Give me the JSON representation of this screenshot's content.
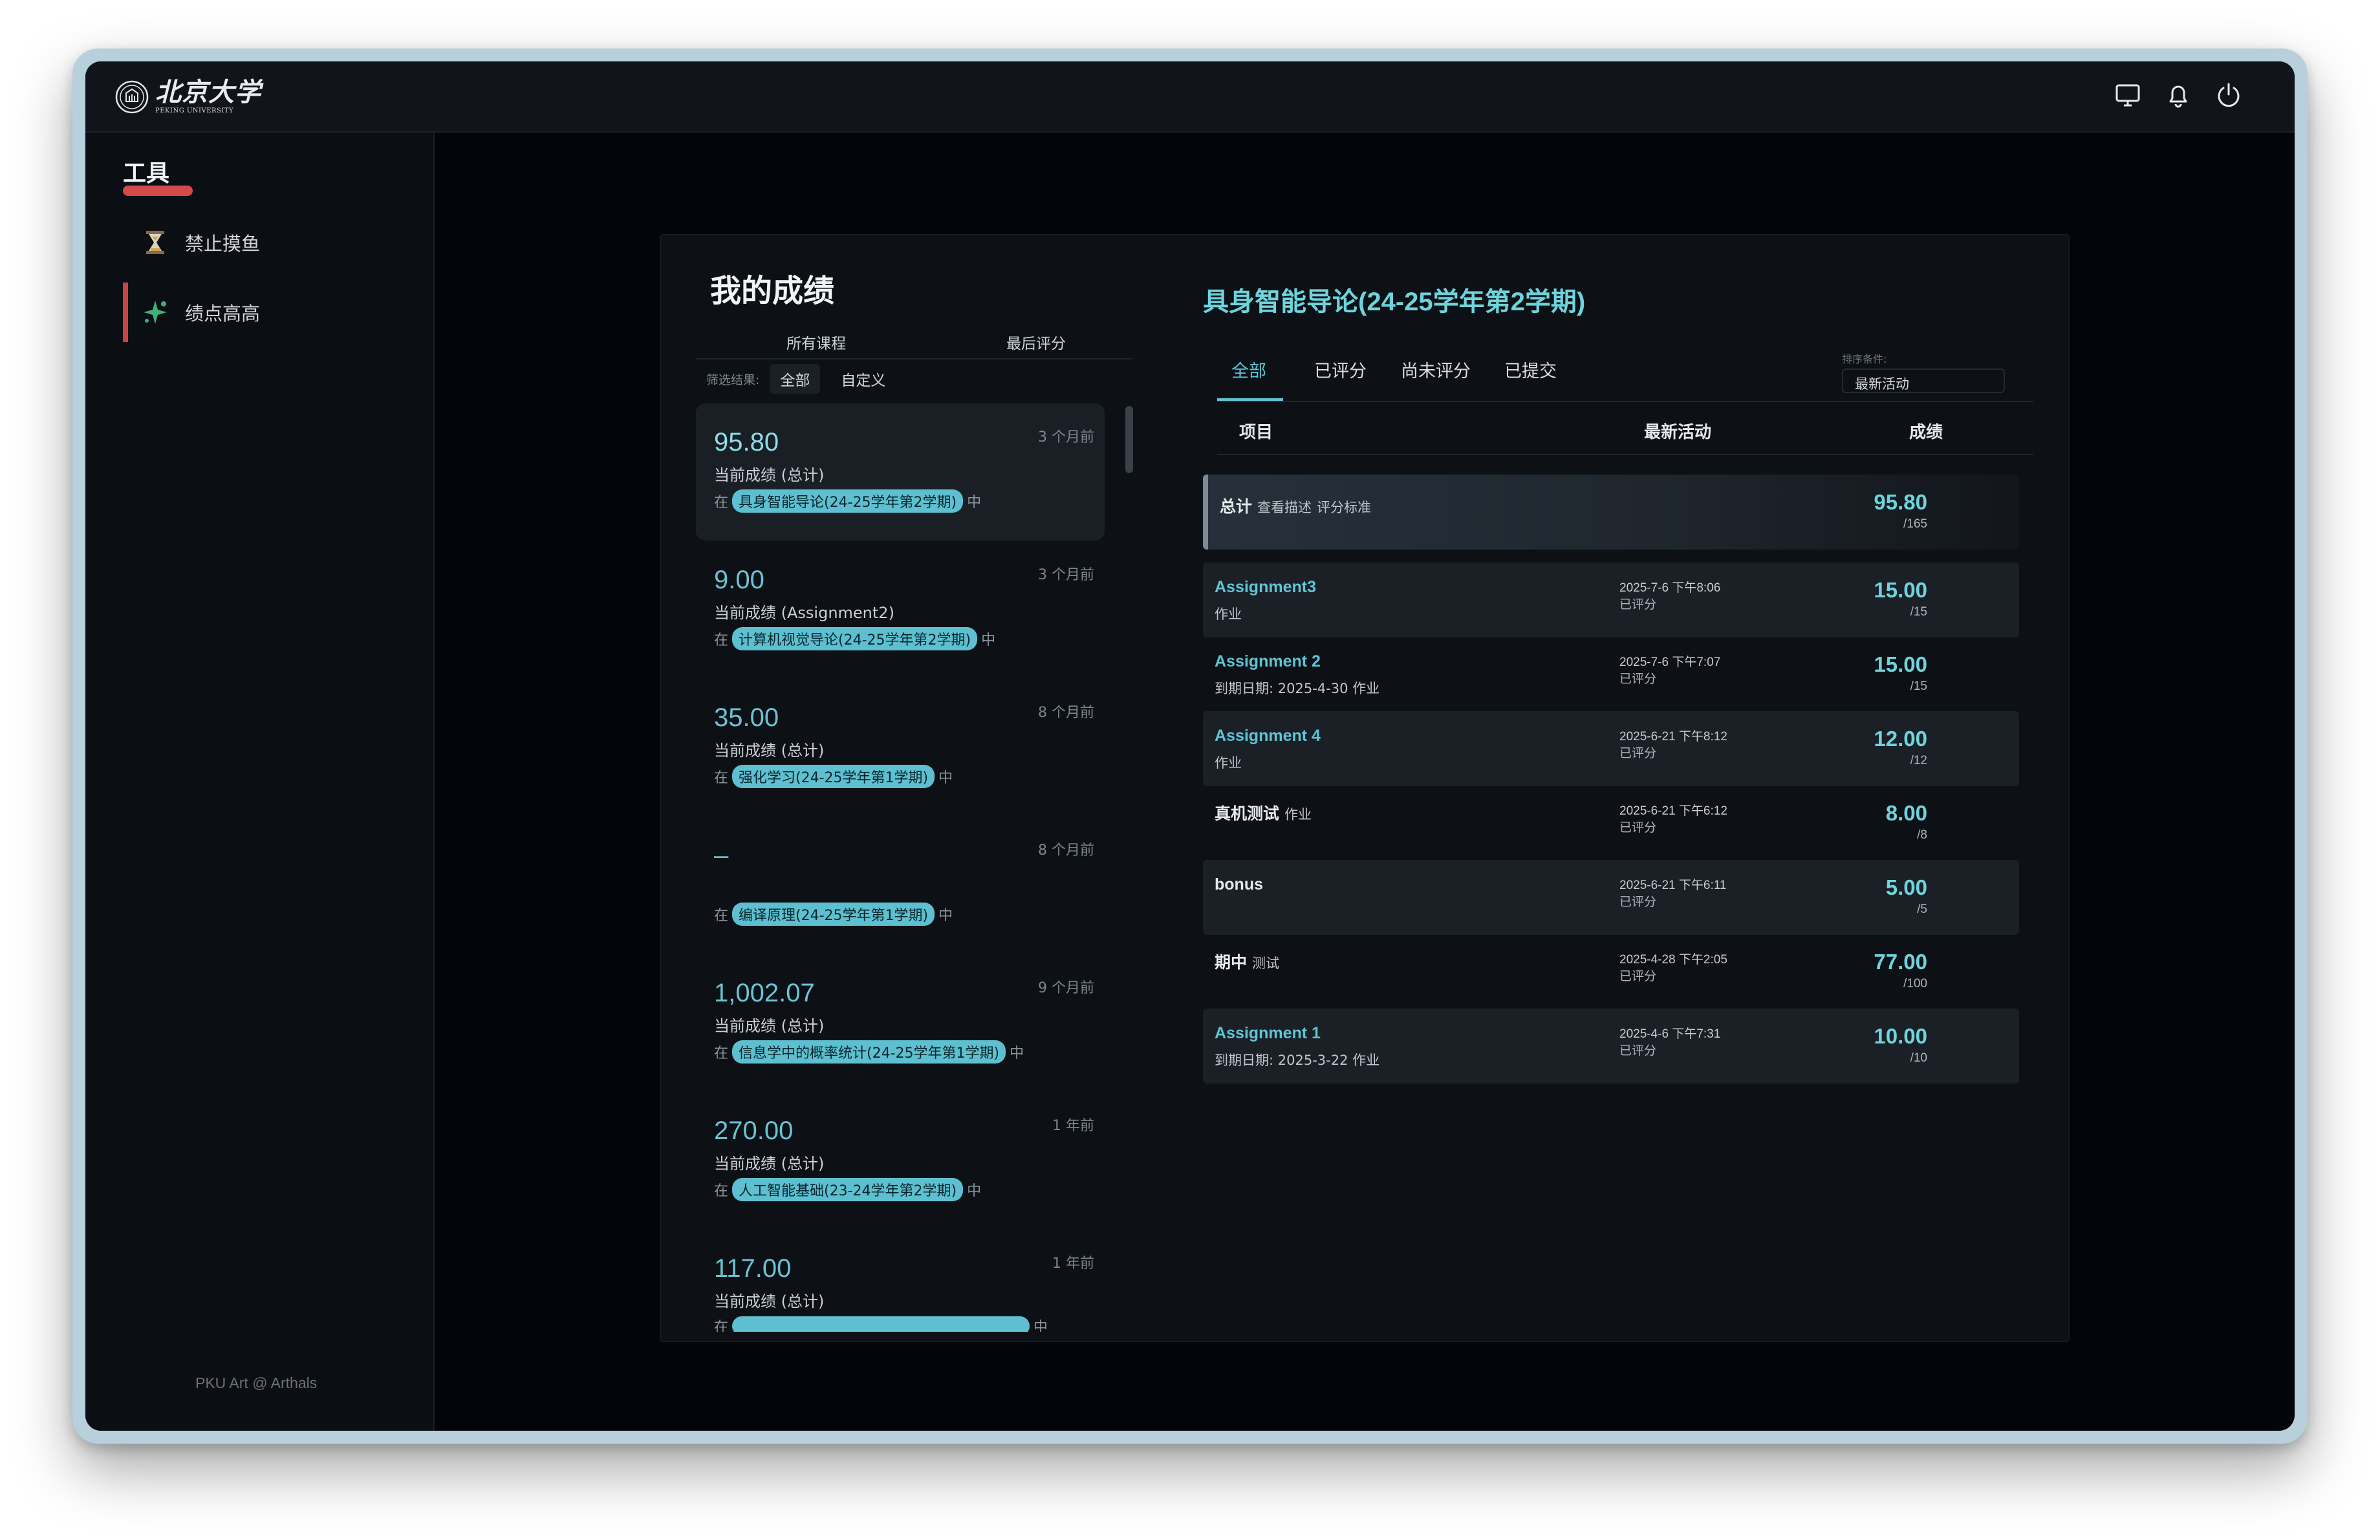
{
  "header": {
    "logo_cn": "北京大学",
    "logo_en": "PEKING UNIVERSITY",
    "icons": [
      "monitor-icon",
      "bell-icon",
      "power-icon"
    ]
  },
  "sidebar": {
    "title": "工具",
    "items": [
      {
        "label": "禁止摸鱼",
        "icon": "hourglass-icon",
        "active": false
      },
      {
        "label": "绩点高高",
        "icon": "sparkle-icon",
        "active": true
      }
    ],
    "footer": "PKU Art @ Arthals"
  },
  "grades": {
    "title": "我的成绩",
    "col_tabs": [
      "所有课程",
      "最后评分"
    ],
    "filter_label": "筛选结果:",
    "filters": [
      "全部",
      "自定义"
    ],
    "in_prefix": "在",
    "in_suffix": "中",
    "items": [
      {
        "value": "95.80",
        "time": "3 个月前",
        "subtitle": "当前成绩 (总计)",
        "course": "具身智能导论(24-25学年第2学期)",
        "selected": true
      },
      {
        "value": "9.00",
        "time": "3 个月前",
        "subtitle": "当前成绩 (Assignment2)",
        "course": "计算机视觉导论(24-25学年第2学期)",
        "selected": false
      },
      {
        "value": "35.00",
        "time": "8 个月前",
        "subtitle": "当前成绩 (总计)",
        "course": "强化学习(24-25学年第1学期)",
        "selected": false
      },
      {
        "value": "–",
        "time": "8 个月前",
        "subtitle": "",
        "course": "编译原理(24-25学年第1学期)",
        "selected": false
      },
      {
        "value": "1,002.07",
        "time": "9 个月前",
        "subtitle": "当前成绩 (总计)",
        "course": "信息学中的概率统计(24-25学年第1学期)",
        "selected": false
      },
      {
        "value": "270.00",
        "time": "1 年前",
        "subtitle": "当前成绩 (总计)",
        "course": "人工智能基础(23-24学年第2学期)",
        "selected": false
      },
      {
        "value": "117.00",
        "time": "1 年前",
        "subtitle": "当前成绩 (总计)",
        "course": "",
        "selected": false
      }
    ]
  },
  "detail": {
    "course_title": "具身智能导论(24-25学年第2学期)",
    "tabs": [
      "全部",
      "已评分",
      "尚未评分",
      "已提交"
    ],
    "sort": {
      "label": "排序条件:",
      "value": "最新活动"
    },
    "columns": [
      "项目",
      "最新活动",
      "成绩"
    ],
    "total": {
      "name": "总计",
      "link1": "查看描述",
      "link2": "评分标准",
      "score": "95.80",
      "max": "/165"
    },
    "rows": [
      {
        "name": "Assignment3",
        "kind": "",
        "sub": "作业",
        "date": "2025-7-6 下午8:06",
        "status": "已评分",
        "score": "15.00",
        "max": "/15",
        "link": true
      },
      {
        "name": "Assignment 2",
        "kind": "",
        "sub": "到期日期: 2025-4-30    作业",
        "date": "2025-7-6 下午7:07",
        "status": "已评分",
        "score": "15.00",
        "max": "/15",
        "link": true
      },
      {
        "name": "Assignment 4",
        "kind": "",
        "sub": "作业",
        "date": "2025-6-21 下午8:12",
        "status": "已评分",
        "score": "12.00",
        "max": "/12",
        "link": true
      },
      {
        "name": "真机测试",
        "kind": "作业",
        "sub": "",
        "date": "2025-6-21 下午6:12",
        "status": "已评分",
        "score": "8.00",
        "max": "/8",
        "link": false
      },
      {
        "name": "bonus",
        "kind": "",
        "sub": "",
        "date": "2025-6-21 下午6:11",
        "status": "已评分",
        "score": "5.00",
        "max": "/5",
        "link": false
      },
      {
        "name": "期中",
        "kind": "测试",
        "sub": "",
        "date": "2025-4-28 下午2:05",
        "status": "已评分",
        "score": "77.00",
        "max": "/100",
        "link": false
      },
      {
        "name": "Assignment 1",
        "kind": "",
        "sub": "到期日期: 2025-3-22    作业",
        "date": "2025-4-6 下午7:31",
        "status": "已评分",
        "score": "10.00",
        "max": "/10",
        "link": true
      }
    ]
  },
  "colors": {
    "accent": "#5ec5d6",
    "danger": "#c94444",
    "background": "#03050a"
  }
}
